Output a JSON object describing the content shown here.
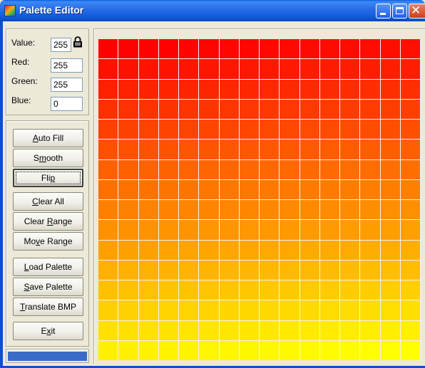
{
  "window": {
    "title": "Palette Editor",
    "icon": "palette-app-icon",
    "controls": [
      "minimize-icon",
      "maximize-icon",
      "close-icon"
    ]
  },
  "values": {
    "value_label": "Value:",
    "value": "255",
    "lock_icon": "lock-icon",
    "red_label": "Red:",
    "red": "255",
    "green_label": "Green:",
    "green": "255",
    "blue_label": "Blue:",
    "blue": "0"
  },
  "buttons": [
    {
      "key": "auto_fill",
      "label": "Auto Fill",
      "mnemonic": "A"
    },
    {
      "key": "smooth",
      "label": "Smooth",
      "mnemonic": "m"
    },
    {
      "key": "flip",
      "label": "Flip",
      "mnemonic": "p",
      "focused": true
    },
    {
      "key": "clear_all",
      "label": "Clear All",
      "mnemonic": "C"
    },
    {
      "key": "clear_range",
      "label": "Clear Range",
      "mnemonic": "R"
    },
    {
      "key": "move_range",
      "label": "Move Range",
      "mnemonic": "v"
    },
    {
      "key": "load_palette",
      "label": "Load Palette",
      "mnemonic": "L"
    },
    {
      "key": "save_palette",
      "label": "Save Palette",
      "mnemonic": "S"
    },
    {
      "key": "translate_bmp",
      "label": "Translate BMP",
      "mnemonic": "T"
    },
    {
      "key": "exit",
      "label": "Exit",
      "mnemonic": "x"
    }
  ],
  "progress": {
    "fraction": 1.0,
    "color": "#3a6bc8"
  },
  "palette": {
    "rows": 16,
    "cols": 16,
    "start_color": "#ff0000",
    "end_color": "#ffff00",
    "gridline_color": "#f2f2f2"
  }
}
